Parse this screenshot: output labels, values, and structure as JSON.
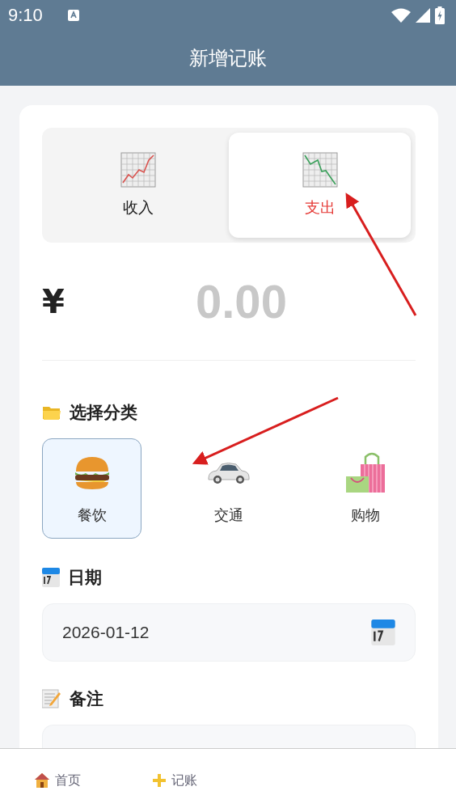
{
  "status_bar": {
    "time": "9:10"
  },
  "header": {
    "title": "新增记账"
  },
  "type_tabs": [
    {
      "label": "收入",
      "kind": "income",
      "selected": false
    },
    {
      "label": "支出",
      "kind": "expense",
      "selected": true
    }
  ],
  "amount": {
    "currency": "¥",
    "value": "0.00"
  },
  "category_section": {
    "title": "选择分类"
  },
  "categories": [
    {
      "label": "餐饮",
      "kind": "food",
      "selected": true
    },
    {
      "label": "交通",
      "kind": "car",
      "selected": false
    },
    {
      "label": "购物",
      "kind": "shopping",
      "selected": false
    }
  ],
  "date_section": {
    "title": "日期",
    "value": "2026-01-12"
  },
  "note_section": {
    "title": "备注"
  },
  "bottom_nav": [
    {
      "label": "首页",
      "kind": "home"
    },
    {
      "label": "记账",
      "kind": "add"
    }
  ]
}
